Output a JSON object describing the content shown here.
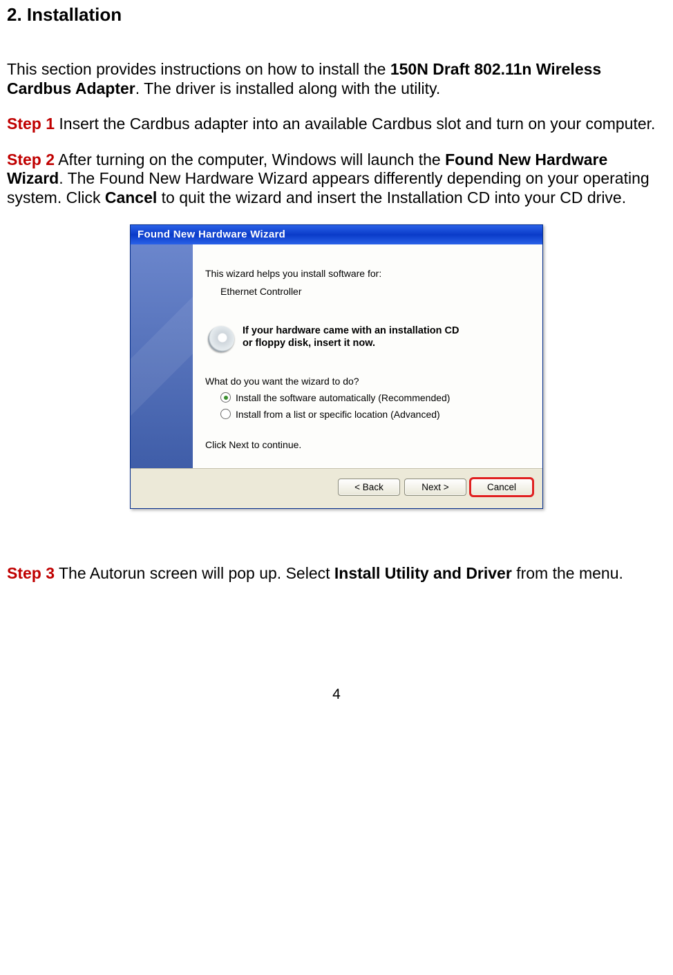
{
  "heading": "2. Installation",
  "intro": {
    "prefix": "This section provides instructions on how to install the ",
    "bold1": "150N Draft 802.11n Wireless Cardbus Adapter",
    "rest": ". The driver is installed along with the utility."
  },
  "step1": {
    "label": "Step 1",
    "text": " Insert the Cardbus adapter into an available Cardbus slot and turn on your computer."
  },
  "step2": {
    "label": "Step 2",
    "t1": " After turning on the computer, Windows will launch the ",
    "b1": "Found New Hardware Wizard",
    "t2": ". The Found New Hardware Wizard appears differently depending on your operating system. Click ",
    "b2": "Cancel",
    "t3": " to quit the wizard and insert the Installation CD into your CD drive."
  },
  "wizard": {
    "title": "Found New Hardware Wizard",
    "helps": "This wizard helps you install software for:",
    "device": "Ethernet Controller",
    "cd1": "If your hardware came with an installation CD",
    "cd2": "or floppy disk, insert it now.",
    "question": "What do you want the wizard to do?",
    "opt1": "Install the software automatically (Recommended)",
    "opt2": "Install from a list or specific location (Advanced)",
    "clickNext": "Click Next to continue.",
    "back": "< Back",
    "next": "Next >",
    "cancel": "Cancel"
  },
  "step3": {
    "label": "Step 3",
    "t1": " The Autorun screen will pop up. Select ",
    "b1": "Install Utility and Driver",
    "t2": " from the menu."
  },
  "pageNumber": "4"
}
